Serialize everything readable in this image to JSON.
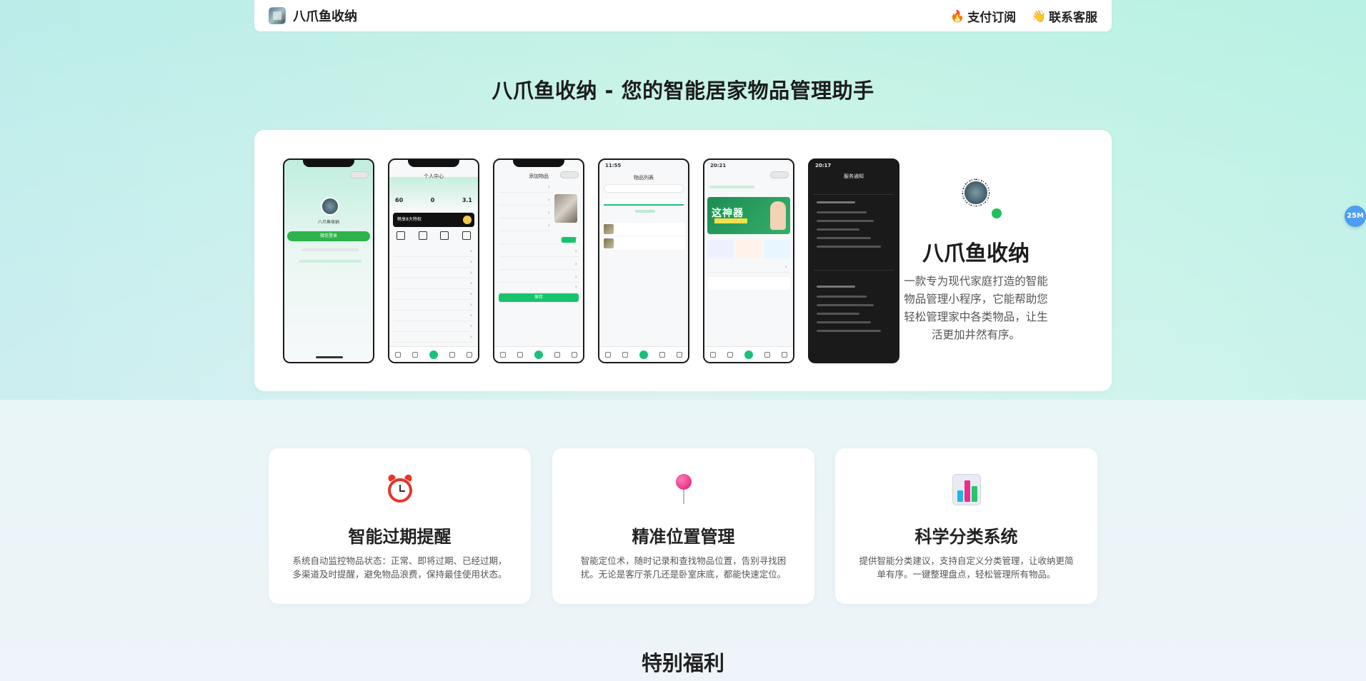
{
  "header": {
    "brand_name": "八爪鱼收纳",
    "nav": [
      {
        "label": "支付订阅",
        "icon": "fire-icon"
      },
      {
        "label": "联系客服",
        "icon": "waving-hand-icon"
      }
    ]
  },
  "hero": {
    "title": "八爪鱼收纳 - 您的智能居家物品管理助手"
  },
  "showcase": {
    "app_name": "八爪鱼收纳",
    "description": "一款专为现代家庭打造的智能物品管理小程序，它能帮助您轻松管理家中各类物品，让生活更加井然有序。",
    "phones": {
      "p1": {
        "name": "八爪鱼收纳",
        "login": "微信登录"
      },
      "p2": {
        "title": "个人中心",
        "stats": [
          "60",
          "0",
          "3.1"
        ],
        "vip": "畅享8大特权"
      },
      "p3": {
        "title": "添加物品",
        "save": "保存"
      },
      "p4": {
        "time": "11:55",
        "title": "物品列表"
      },
      "p5": {
        "time": "20:21",
        "banner": "这神器"
      },
      "p6": {
        "time": "20:17",
        "title": "服务通知"
      }
    }
  },
  "features": [
    {
      "title": "智能过期提醒",
      "desc": "系统自动监控物品状态：正常、即将过期、已经过期，多渠道及时提醒，避免物品浪费，保持最佳使用状态。",
      "icon": "alarm-clock-icon"
    },
    {
      "title": "精准位置管理",
      "desc": "智能定位术，随时记录和查找物品位置，告别寻找困扰。无论是客厅茶几还是卧室床底，都能快速定位。",
      "icon": "pushpin-icon"
    },
    {
      "title": "科学分类系统",
      "desc": "提供智能分类建议，支持自定义分类管理，让收纳更简单有序。一键整理盘点，轻松管理所有物品。",
      "icon": "bar-chart-icon"
    }
  ],
  "section": {
    "title": "特别福利"
  },
  "float_badge": "25M",
  "colors": {
    "accent_green": "#19c17a",
    "alarm_red": "#e8342a",
    "pin_pink": "#e3156f",
    "badge_blue": "#4d9ef0"
  }
}
